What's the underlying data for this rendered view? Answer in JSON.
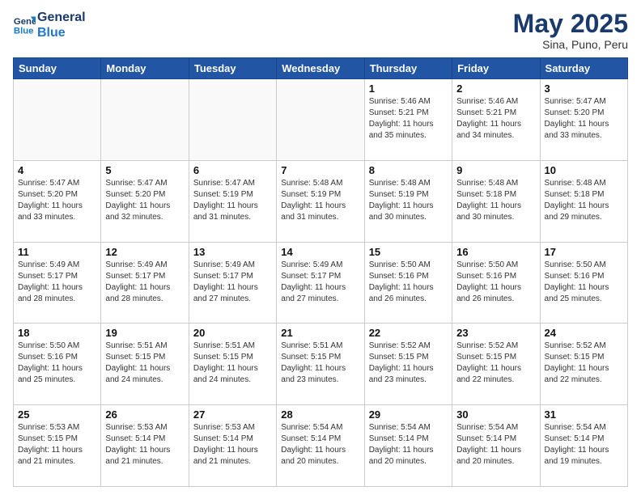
{
  "header": {
    "logo_line1": "General",
    "logo_line2": "Blue",
    "month": "May 2025",
    "location": "Sina, Puno, Peru"
  },
  "weekdays": [
    "Sunday",
    "Monday",
    "Tuesday",
    "Wednesday",
    "Thursday",
    "Friday",
    "Saturday"
  ],
  "weeks": [
    [
      {
        "day": "",
        "info": ""
      },
      {
        "day": "",
        "info": ""
      },
      {
        "day": "",
        "info": ""
      },
      {
        "day": "",
        "info": ""
      },
      {
        "day": "1",
        "info": "Sunrise: 5:46 AM\nSunset: 5:21 PM\nDaylight: 11 hours\nand 35 minutes."
      },
      {
        "day": "2",
        "info": "Sunrise: 5:46 AM\nSunset: 5:21 PM\nDaylight: 11 hours\nand 34 minutes."
      },
      {
        "day": "3",
        "info": "Sunrise: 5:47 AM\nSunset: 5:20 PM\nDaylight: 11 hours\nand 33 minutes."
      }
    ],
    [
      {
        "day": "4",
        "info": "Sunrise: 5:47 AM\nSunset: 5:20 PM\nDaylight: 11 hours\nand 33 minutes."
      },
      {
        "day": "5",
        "info": "Sunrise: 5:47 AM\nSunset: 5:20 PM\nDaylight: 11 hours\nand 32 minutes."
      },
      {
        "day": "6",
        "info": "Sunrise: 5:47 AM\nSunset: 5:19 PM\nDaylight: 11 hours\nand 31 minutes."
      },
      {
        "day": "7",
        "info": "Sunrise: 5:48 AM\nSunset: 5:19 PM\nDaylight: 11 hours\nand 31 minutes."
      },
      {
        "day": "8",
        "info": "Sunrise: 5:48 AM\nSunset: 5:19 PM\nDaylight: 11 hours\nand 30 minutes."
      },
      {
        "day": "9",
        "info": "Sunrise: 5:48 AM\nSunset: 5:18 PM\nDaylight: 11 hours\nand 30 minutes."
      },
      {
        "day": "10",
        "info": "Sunrise: 5:48 AM\nSunset: 5:18 PM\nDaylight: 11 hours\nand 29 minutes."
      }
    ],
    [
      {
        "day": "11",
        "info": "Sunrise: 5:49 AM\nSunset: 5:17 PM\nDaylight: 11 hours\nand 28 minutes."
      },
      {
        "day": "12",
        "info": "Sunrise: 5:49 AM\nSunset: 5:17 PM\nDaylight: 11 hours\nand 28 minutes."
      },
      {
        "day": "13",
        "info": "Sunrise: 5:49 AM\nSunset: 5:17 PM\nDaylight: 11 hours\nand 27 minutes."
      },
      {
        "day": "14",
        "info": "Sunrise: 5:49 AM\nSunset: 5:17 PM\nDaylight: 11 hours\nand 27 minutes."
      },
      {
        "day": "15",
        "info": "Sunrise: 5:50 AM\nSunset: 5:16 PM\nDaylight: 11 hours\nand 26 minutes."
      },
      {
        "day": "16",
        "info": "Sunrise: 5:50 AM\nSunset: 5:16 PM\nDaylight: 11 hours\nand 26 minutes."
      },
      {
        "day": "17",
        "info": "Sunrise: 5:50 AM\nSunset: 5:16 PM\nDaylight: 11 hours\nand 25 minutes."
      }
    ],
    [
      {
        "day": "18",
        "info": "Sunrise: 5:50 AM\nSunset: 5:16 PM\nDaylight: 11 hours\nand 25 minutes."
      },
      {
        "day": "19",
        "info": "Sunrise: 5:51 AM\nSunset: 5:15 PM\nDaylight: 11 hours\nand 24 minutes."
      },
      {
        "day": "20",
        "info": "Sunrise: 5:51 AM\nSunset: 5:15 PM\nDaylight: 11 hours\nand 24 minutes."
      },
      {
        "day": "21",
        "info": "Sunrise: 5:51 AM\nSunset: 5:15 PM\nDaylight: 11 hours\nand 23 minutes."
      },
      {
        "day": "22",
        "info": "Sunrise: 5:52 AM\nSunset: 5:15 PM\nDaylight: 11 hours\nand 23 minutes."
      },
      {
        "day": "23",
        "info": "Sunrise: 5:52 AM\nSunset: 5:15 PM\nDaylight: 11 hours\nand 22 minutes."
      },
      {
        "day": "24",
        "info": "Sunrise: 5:52 AM\nSunset: 5:15 PM\nDaylight: 11 hours\nand 22 minutes."
      }
    ],
    [
      {
        "day": "25",
        "info": "Sunrise: 5:53 AM\nSunset: 5:15 PM\nDaylight: 11 hours\nand 21 minutes."
      },
      {
        "day": "26",
        "info": "Sunrise: 5:53 AM\nSunset: 5:14 PM\nDaylight: 11 hours\nand 21 minutes."
      },
      {
        "day": "27",
        "info": "Sunrise: 5:53 AM\nSunset: 5:14 PM\nDaylight: 11 hours\nand 21 minutes."
      },
      {
        "day": "28",
        "info": "Sunrise: 5:54 AM\nSunset: 5:14 PM\nDaylight: 11 hours\nand 20 minutes."
      },
      {
        "day": "29",
        "info": "Sunrise: 5:54 AM\nSunset: 5:14 PM\nDaylight: 11 hours\nand 20 minutes."
      },
      {
        "day": "30",
        "info": "Sunrise: 5:54 AM\nSunset: 5:14 PM\nDaylight: 11 hours\nand 20 minutes."
      },
      {
        "day": "31",
        "info": "Sunrise: 5:54 AM\nSunset: 5:14 PM\nDaylight: 11 hours\nand 19 minutes."
      }
    ]
  ]
}
